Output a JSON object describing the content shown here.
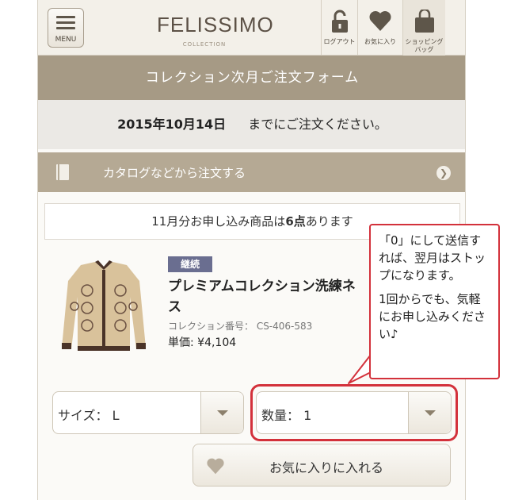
{
  "header": {
    "menu_label": "MENU",
    "logo": "FELISSIMO",
    "logo_sub": "COLLECTION",
    "logout_label": "ログアウト",
    "favorites_label": "お気に入り",
    "bag_label_1": "ショッピング",
    "bag_label_2": "バッグ"
  },
  "title": "コレクション次月ご注文フォーム",
  "deadline": {
    "date": "2015年10月14日",
    "text": "までにご注文ください。"
  },
  "catalog_link": "カタログなどから注文する",
  "notice": {
    "prefix": "11月分お申し込み商品は",
    "count": "6点",
    "suffix": "あります"
  },
  "product": {
    "badge": "継続",
    "name": "プレミアムコレクション洗練ネ",
    "name_line2": "ス",
    "collection_number": "コレクション番号： CS-406-583",
    "price": "単価: ¥4,104"
  },
  "size_select": {
    "value": "サイズ：  L"
  },
  "quantity_select": {
    "value": "数量：  1"
  },
  "favorite_button": "お気に入りに入れる",
  "callout": {
    "para1": "「0」にして送信すれば、翌月はストップになります。",
    "para2": "1回からでも、気軽にお申し込みください♪"
  },
  "colors": {
    "accent_red": "#d3313b",
    "title_bar": "#a69a85",
    "badge": "#6a6e90"
  }
}
